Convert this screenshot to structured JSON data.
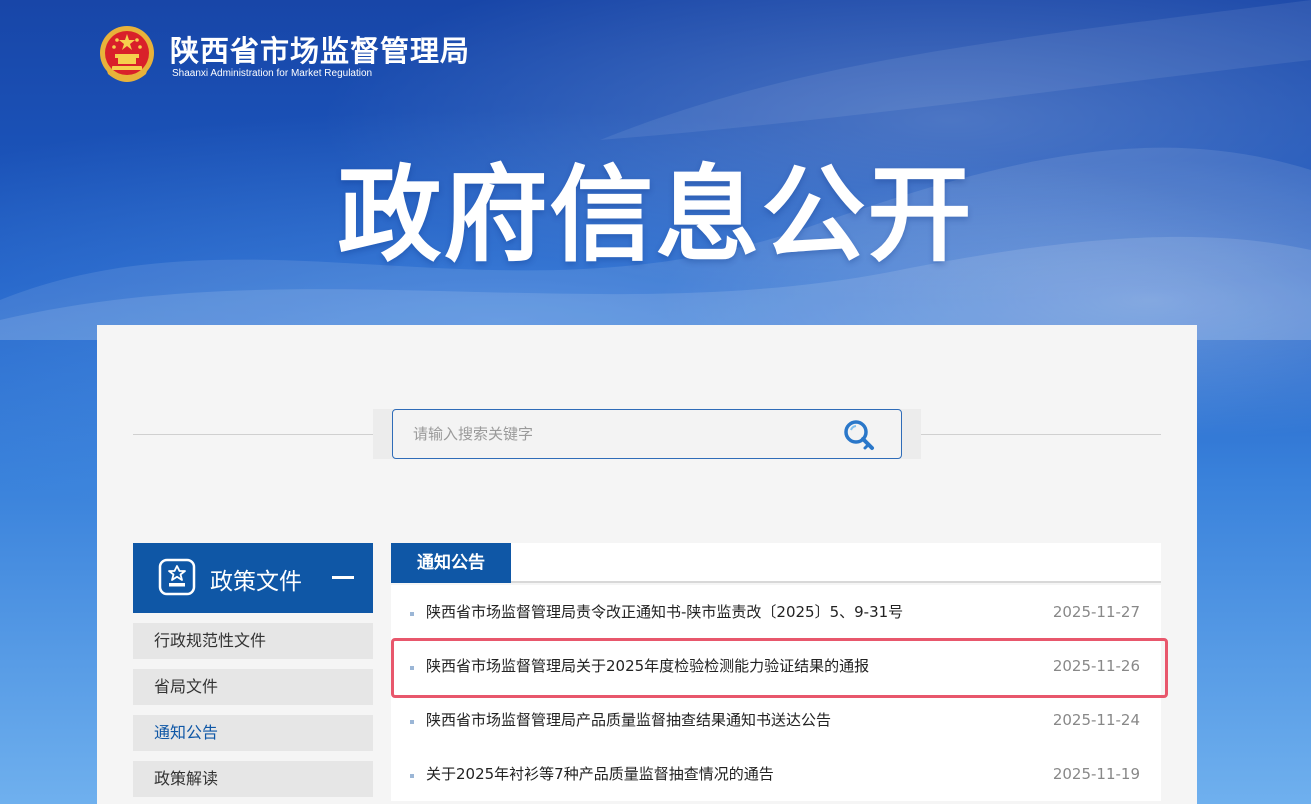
{
  "header": {
    "org_name_cn": "陕西省市场监督管理局",
    "org_name_en": "Shaanxi Administration for Market Regulation",
    "hero_title": "政府信息公开"
  },
  "search": {
    "placeholder": "请输入搜索关键字",
    "value": ""
  },
  "sidebar": {
    "section_title": "政策文件",
    "items": [
      {
        "label": "行政规范性文件",
        "active": false
      },
      {
        "label": "省局文件",
        "active": false
      },
      {
        "label": "通知公告",
        "active": true
      },
      {
        "label": "政策解读",
        "active": false
      }
    ]
  },
  "main": {
    "tab_label": "通知公告",
    "rows": [
      {
        "title": "陕西省市场监督管理局责令改正通知书-陕市监责改〔2025〕5、9-31号",
        "date": "2025-11-27"
      },
      {
        "title": "陕西省市场监督管理局关于2025年度检验检测能力验证结果的通报",
        "date": "2025-11-26"
      },
      {
        "title": "陕西省市场监督管理局产品质量监督抽查结果通知书送达公告",
        "date": "2025-11-24"
      },
      {
        "title": "关于2025年衬衫等7种产品质量监督抽查情况的通告",
        "date": "2025-11-19"
      }
    ]
  },
  "colors": {
    "brand_blue": "#0f57a6",
    "highlight_red": "#e8576c"
  },
  "icons": {
    "emblem": "national-emblem-icon",
    "search": "search-icon",
    "document": "document-icon",
    "collapse": "minus-icon"
  }
}
